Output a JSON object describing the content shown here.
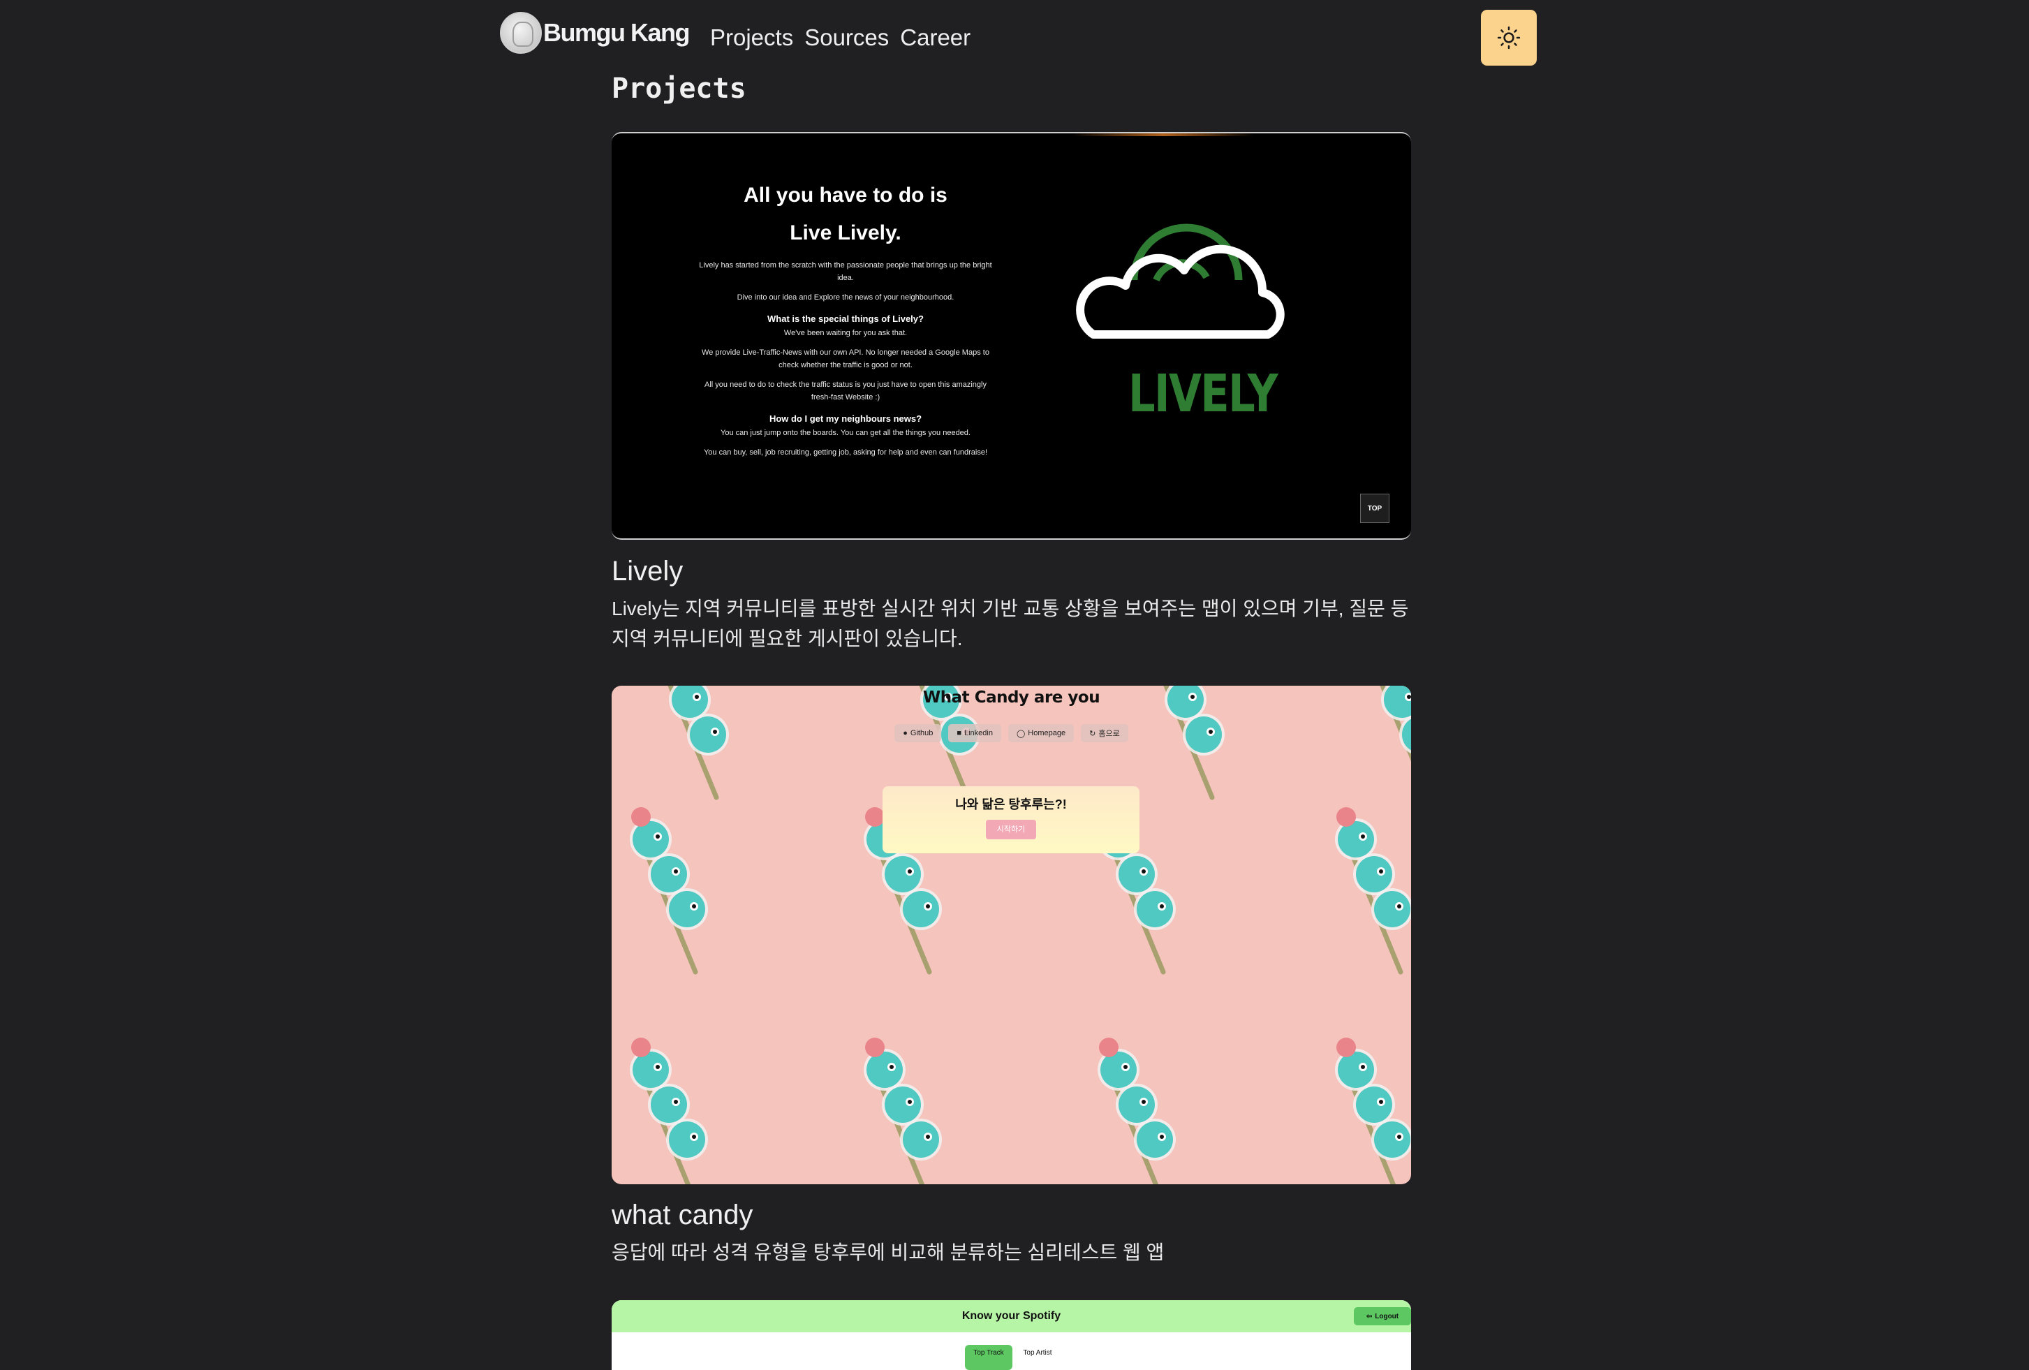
{
  "header": {
    "logo_text": "Bumgu Kang",
    "nav": [
      "Projects",
      "Sources",
      "Career"
    ],
    "theme_toggle_icon": "sun-icon",
    "theme_toggle_color": "#fbd38d"
  },
  "page": {
    "title": "Projects",
    "background": "#202023"
  },
  "projects": [
    {
      "title": "Lively",
      "description": "Lively는 지역 커뮤니티를 표방한 실시간 위치 기반 교통 상황을 보여주는 맵이 있으며 기부, 질문 등 지역 커뮤니티에 필요한 게시판이 있습니다.",
      "preview": {
        "heading_line1": "All you have to do is",
        "heading_line2": "Live Lively.",
        "p1": "Lively has started from the scratch with the passionate people that brings up the bright idea.",
        "p2": "Dive into our idea and Explore the news of your neighbourhood.",
        "h2": "What is the special things of Lively?",
        "p3": "We've been waiting for you ask that.",
        "p4": "We provide Live-Traffic-News with our own API. No longer needed a Google Maps to check whether the traffic is good or not.",
        "p5": "All you need to do to check the traffic status is you just have to open this amazingly fresh-fast Website :)",
        "h3": "How do I get my neighbours news?",
        "p6": "You can just jump onto the boards. You can get all the things you needed.",
        "p7": "You can buy, sell, job recruiting, getting job, asking for help and even can fundraise!",
        "wordmark": "LIVELY",
        "top_button": "TOP",
        "brand_color": "#2e7d32"
      }
    },
    {
      "title": "what candy",
      "description": "응답에 따라 성격 유형을 탕후루에 비교해 분류하는 심리테스트 웹 앱",
      "preview": {
        "heading": "What Candy are you",
        "buttons": [
          "Github",
          "Linkedin",
          "Homepage",
          "홈으로"
        ],
        "question": "나와 닮은 탕후루는?!",
        "start": "시작하기",
        "background": "#f5c4bd"
      }
    },
    {
      "title": "",
      "description": "",
      "preview": {
        "heading": "Know your Spotify",
        "logout": "Logout",
        "tab1": "Top Track",
        "tab2": "Top Artist",
        "bar_color": "#b6f5a6"
      }
    }
  ]
}
